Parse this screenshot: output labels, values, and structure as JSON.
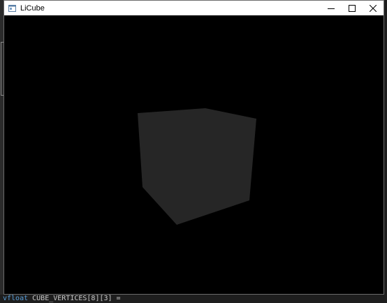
{
  "window": {
    "title": "LiCube",
    "controls": {
      "minimize_icon": "minimize-icon",
      "maximize_icon": "maximize-icon",
      "close_icon": "close-icon"
    }
  },
  "viewport": {
    "background": "#000000",
    "cube_color": "#262626"
  },
  "background_editor": {
    "code_keyword": "vfloat",
    "code_rest": " CUBE_VERTICES[8][3] ="
  }
}
